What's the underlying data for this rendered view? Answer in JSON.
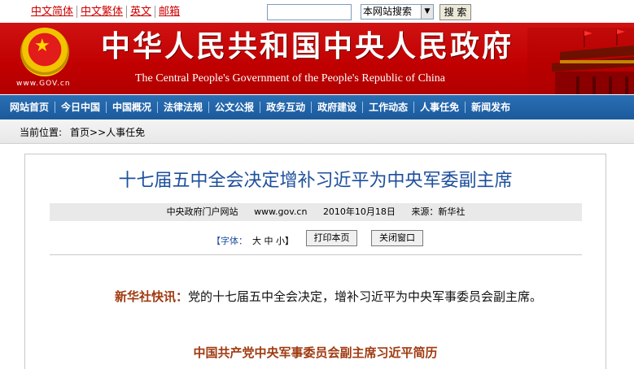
{
  "topbar": {
    "lang_links": [
      "中文简体",
      "中文繁体",
      "英文",
      "邮箱"
    ],
    "search_placeholder": "",
    "search_scope": "本网站搜索",
    "search_button": "搜 索"
  },
  "banner": {
    "title": "中华人民共和国中央人民政府",
    "subtitle": "The Central People's Government of the People's Republic of China",
    "url": "www.GOV.cn"
  },
  "nav": {
    "items": [
      "网站首页",
      "今日中国",
      "中国概况",
      "法律法规",
      "公文公报",
      "政务互动",
      "政府建设",
      "工作动态",
      "人事任免",
      "新闻发布"
    ]
  },
  "breadcrumb": {
    "label": "当前位置:",
    "home": "首页>>",
    "current": "人事任免"
  },
  "article": {
    "title": "十七届五中全会决定增补习近平为中央军委副主席",
    "meta": {
      "site": "中央政府门户网站",
      "url": "www.gov.cn",
      "date": "2010年10月18日",
      "source": "来源：新华社"
    },
    "font_size_label": "【字体：",
    "font_sizes": "大 中 小】",
    "print_button": "打印本页",
    "close_button": "关闭窗口",
    "lead_source": "新华社快讯：",
    "lead_text": "党的十七届五中全会决定，增补习近平为中央军事委员会副主席。",
    "section_heading": "中国共产党中央军事委员会副主席习近平简历"
  },
  "colors": {
    "banner_red": "#c00000",
    "nav_blue": "#1a5a9c",
    "title_blue": "#1d4f9c",
    "accent_brown": "#a03a10"
  }
}
